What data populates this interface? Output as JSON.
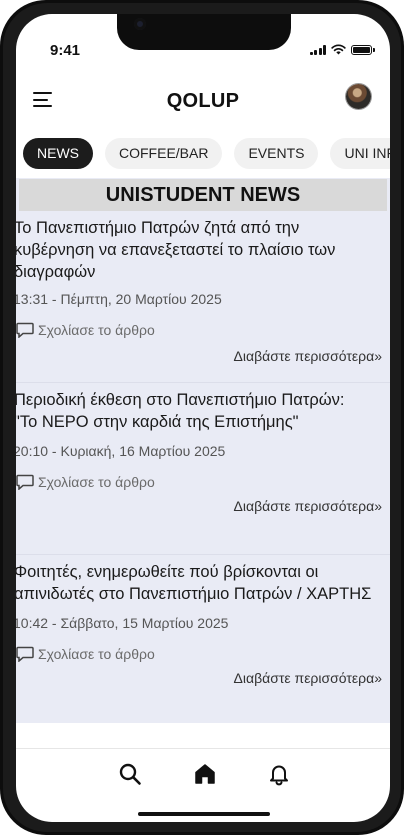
{
  "status": {
    "time": "9:41"
  },
  "header": {
    "title": "QOLUP"
  },
  "tabs": [
    {
      "label": "NEWS",
      "active": true
    },
    {
      "label": "COFFEE/BAR",
      "active": false
    },
    {
      "label": "EVENTS",
      "active": false
    },
    {
      "label": "UNI INFO",
      "active": false
    }
  ],
  "feed": {
    "heading": "UNISTUDENT NEWS",
    "articles": [
      {
        "title_lines": [
          "Το Πανεπιστήμιο Πατρών ζητά από την",
          "κυβέρνηση να επανεξεταστεί το πλαίσιο των",
          "διαγραφών"
        ],
        "datetime": "13:31 - Πέμπτη, 20 Μαρτίου 2025",
        "comment_label": "Σχολίασε το άρθρο",
        "more_label": "Διαβάστε περισσότερα»"
      },
      {
        "title_lines": [
          "Περιοδική έκθεση στο Πανεπιστήμιο Πατρών:",
          "\"Το ΝΕΡΟ στην καρδιά της Επιστήμης\""
        ],
        "datetime": "20:10 - Κυριακή, 16 Μαρτίου 2025",
        "comment_label": "Σχολίασε το άρθρο",
        "more_label": "Διαβάστε περισσότερα»"
      },
      {
        "title_lines": [
          "Φοιτητές, ενημερωθείτε πού βρίσκονται οι",
          "απινιδωτές στο Πανεπιστήμιο Πατρών / ΧΑΡΤΗΣ"
        ],
        "datetime": "10:42 - Σάββατο, 15 Μαρτίου 2025",
        "comment_label": "Σχολίασε το άρθρο",
        "more_label": "Διαβάστε περισσότερα»"
      }
    ]
  },
  "bottom_nav": [
    {
      "icon": "search-icon"
    },
    {
      "icon": "home-icon"
    },
    {
      "icon": "bell-icon"
    }
  ]
}
